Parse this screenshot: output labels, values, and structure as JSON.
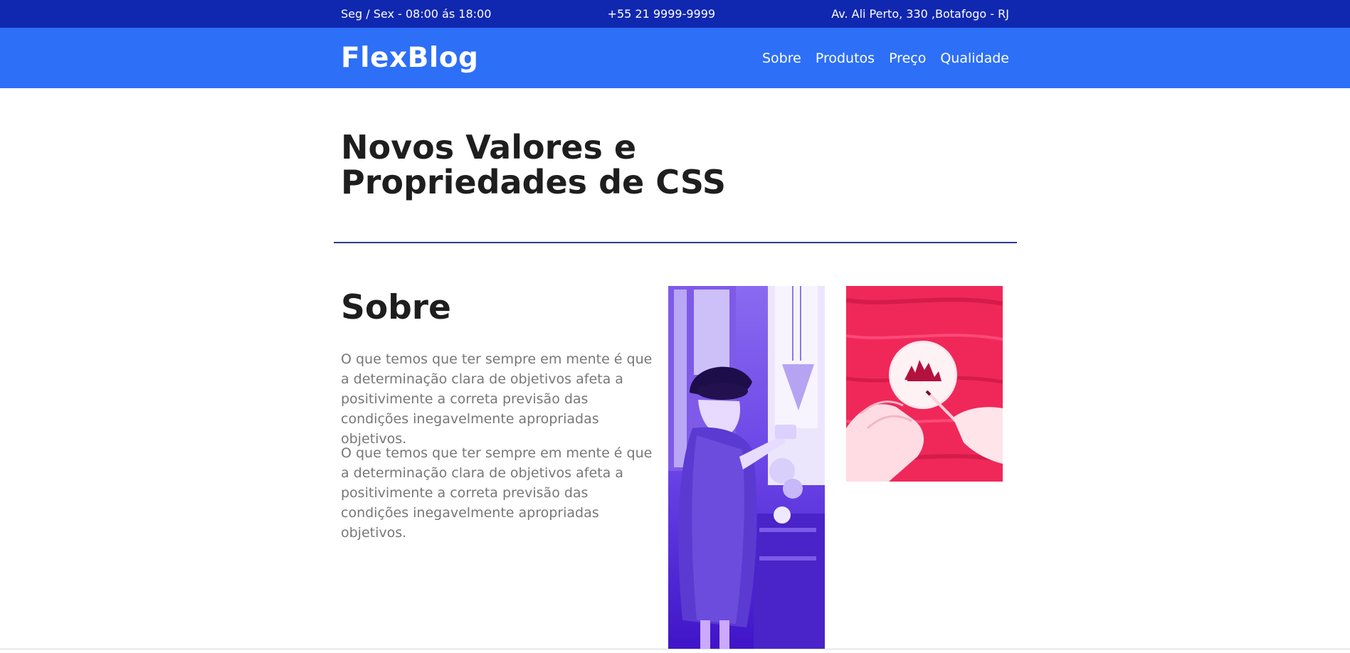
{
  "topbar": {
    "hours": "Seg / Sex - 08:00 ás 18:00",
    "phone": "+55 21 9999-9999",
    "address": "Av. Ali Perto, 330 ,Botafogo - RJ"
  },
  "navbar": {
    "logo": "FlexBlog",
    "menu": [
      "Sobre",
      "Produtos",
      "Preço",
      "Qualidade"
    ]
  },
  "hero": {
    "title_line1": "Novos Valores e",
    "title_line2": "Propriedades de CSS"
  },
  "about": {
    "title": "Sobre",
    "paragraphs": [
      "O que temos que ter sempre em mente é que a determinação clara de objetivos afeta a positivimente a correta previsão das condições inegavelmente apropriadas objetivos.",
      "O que temos que ter sempre em mente é que a determinação clara de objetivos afeta a positivimente a correta previsão das condições inegavelmente apropriadas objetivos."
    ]
  },
  "colors": {
    "topbar": "#1028b0",
    "navbar": "#2d6ff7",
    "divider": "#2a3a8c",
    "photo1_tint": "#5b2ee0",
    "photo2_tint": "#f0285a"
  }
}
